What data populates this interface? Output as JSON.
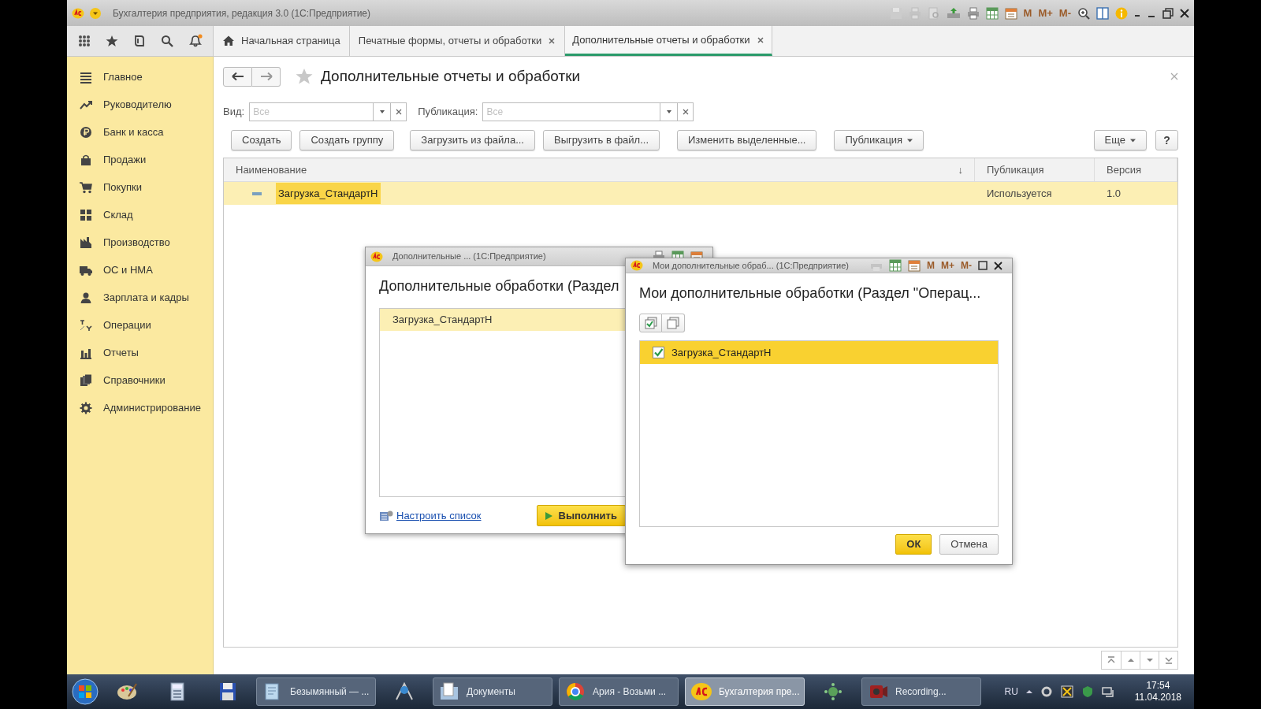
{
  "window": {
    "title": "Бухгалтерия предприятия, редакция 3.0 (1С:Предприятие)",
    "memory_buttons": [
      "M",
      "M+",
      "M-"
    ]
  },
  "tabs": [
    {
      "label": "Начальная страница",
      "selected": false,
      "closable": false
    },
    {
      "label": "Печатные формы, отчеты и обработки",
      "selected": false,
      "closable": true
    },
    {
      "label": "Дополнительные отчеты и обработки",
      "selected": true,
      "closable": true
    }
  ],
  "sidebar": {
    "items": [
      {
        "label": "Главное"
      },
      {
        "label": "Руководителю"
      },
      {
        "label": "Банк и касса"
      },
      {
        "label": "Продажи"
      },
      {
        "label": "Покупки"
      },
      {
        "label": "Склад"
      },
      {
        "label": "Производство"
      },
      {
        "label": "ОС и НМА"
      },
      {
        "label": "Зарплата и кадры"
      },
      {
        "label": "Операции"
      },
      {
        "label": "Отчеты"
      },
      {
        "label": "Справочники"
      },
      {
        "label": "Администрирование"
      }
    ]
  },
  "form": {
    "title": "Дополнительные отчеты и обработки",
    "filters": [
      {
        "label": "Вид:",
        "placeholder": "Все"
      },
      {
        "label": "Публикация:",
        "placeholder": "Все"
      }
    ],
    "buttons": [
      {
        "label": "Создать",
        "dropdown": false
      },
      {
        "label": "Создать группу",
        "dropdown": false
      },
      {
        "label": "Загрузить из файла...",
        "dropdown": false
      },
      {
        "label": "Выгрузить в файл...",
        "dropdown": false
      },
      {
        "label": "Изменить выделенные...",
        "dropdown": false
      },
      {
        "label": "Публикация",
        "dropdown": true
      }
    ],
    "more_button": {
      "label": "Еще",
      "dropdown": true
    },
    "help_button": "?",
    "table": {
      "columns": [
        {
          "label": "Наименование",
          "sort": "↓"
        },
        {
          "label": "Публикация"
        },
        {
          "label": "Версия"
        }
      ],
      "rows": [
        {
          "cells": [
            "Загрузка_СтандартН",
            "Используется",
            "1.0"
          ],
          "selected": true
        }
      ]
    }
  },
  "dialogs": [
    {
      "kind": "run_list",
      "title": "Дополнительные ... (1С:Предприятие)",
      "heading": "Дополнительные обработки (Раздел",
      "rows": [
        {
          "label": "Загрузка_СтандартН",
          "selected": true
        }
      ],
      "link": "Настроить список",
      "run_button": "Выполнить"
    },
    {
      "kind": "check_list",
      "title": "Мои дополнительные обраб... (1С:Предприятие)",
      "memory_buttons": [
        "M",
        "M+",
        "M-"
      ],
      "heading": "Мои дополнительные обработки (Раздел \"Операц...",
      "rows": [
        {
          "label": "Загрузка_СтандартН",
          "checked": true,
          "selected": true
        }
      ],
      "ok_button": "ОК",
      "cancel_button": "Отмена"
    }
  ],
  "taskbar": {
    "items": [
      {
        "kind": "pinned"
      },
      {
        "kind": "pinned"
      },
      {
        "kind": "pinned"
      },
      {
        "kind": "window",
        "label": "Безымянный — ...",
        "selected": false
      },
      {
        "kind": "pinned"
      },
      {
        "kind": "window",
        "label": "Документы",
        "selected": false
      },
      {
        "kind": "window",
        "label": "Ария - Возьми ...",
        "selected": false
      },
      {
        "kind": "window",
        "label": "Бухгалтерия пре...",
        "selected": true
      },
      {
        "kind": "pinned"
      },
      {
        "kind": "window",
        "label": "Recording...",
        "selected": false
      }
    ],
    "lang": "RU",
    "time": "17:54",
    "date": "11.04.2018"
  }
}
